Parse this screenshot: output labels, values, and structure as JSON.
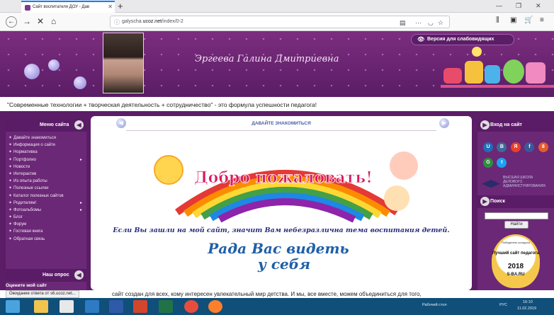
{
  "browser": {
    "tab_title": "Сайт воспитателя ДОУ - Дав",
    "tab_close": "✕",
    "new_tab": "+",
    "url_prefix": "galyscha.",
    "url_host": "ucoz.net",
    "url_path": "/index/0-2",
    "menu_dots": "···"
  },
  "header": {
    "title": "Эргеева Галина Дмитриевна",
    "version_button": "Версия для слабовидящих"
  },
  "slogan": "\"Современные технологии + творческая деятельность + сотрудничество\" - это формула успешности педагога!",
  "left_sidebar": {
    "menu_title": "Меню сайта",
    "items": [
      {
        "label": "Давайте знакомиться",
        "sub": ""
      },
      {
        "label": "Информация о сайте",
        "sub": ""
      },
      {
        "label": "Нормативка",
        "sub": ""
      },
      {
        "label": "Портфолио",
        "sub": "▸"
      },
      {
        "label": "Новости",
        "sub": ""
      },
      {
        "label": "Интерактив",
        "sub": ""
      },
      {
        "label": "Из опыта работы",
        "sub": ""
      },
      {
        "label": "Полезные ссылки",
        "sub": ""
      },
      {
        "label": "Каталог полезных сайтов",
        "sub": ""
      },
      {
        "label": "Родителям!",
        "sub": "▸"
      },
      {
        "label": "Фотоальбомы",
        "sub": "▸"
      },
      {
        "label": "Блог",
        "sub": ""
      },
      {
        "label": "Форум",
        "sub": ""
      },
      {
        "label": "Гостевая книга",
        "sub": ""
      },
      {
        "label": "Обратная связь",
        "sub": ""
      }
    ],
    "poll_title": "Наш опрос",
    "poll_question": "Оцените мой сайт"
  },
  "main": {
    "heading": "ДАВАЙТЕ ЗНАКОМИТЬСЯ",
    "welcome_text": "Добро пожаловать!",
    "tagline": "Если Вы зашли на мой сайт, значит Вам небезразлична тема воспитания  детей.",
    "script_line1": "Рада Вас видеть",
    "script_line2": "у себя",
    "body_text": "сайт создан для всех, кому интересен увлекательный мир детства. И мы, все вместе, можем объединиться для того,"
  },
  "right_sidebar": {
    "login_title": "Вход на сайт",
    "socials": [
      {
        "letter": "U",
        "color": "#1e6fb8"
      },
      {
        "letter": "В",
        "color": "#3d6a99"
      },
      {
        "letter": "Я",
        "color": "#e8402a"
      },
      {
        "letter": "f",
        "color": "#3b5998"
      },
      {
        "letter": "8",
        "color": "#e35b2e"
      },
      {
        "letter": "G",
        "color": "#2f8e3f"
      },
      {
        "letter": "t",
        "color": "#1da1f2"
      }
    ],
    "school_text": "Высшая школа делового администрирования",
    "search_title": "Поиск",
    "search_button": "Найти",
    "badge_line1": "Победитель конкурса",
    "badge_line2": "Лучший сайт педагога",
    "badge_year": "2018",
    "badge_site": "S-BA.RU"
  },
  "status_text": "Ожидание ответа от s6.ucoz.net...",
  "taskbar": {
    "desktop_label": "Рабочий стол",
    "lang": "РУС",
    "time": "16:10",
    "date": "11.02.2019"
  }
}
